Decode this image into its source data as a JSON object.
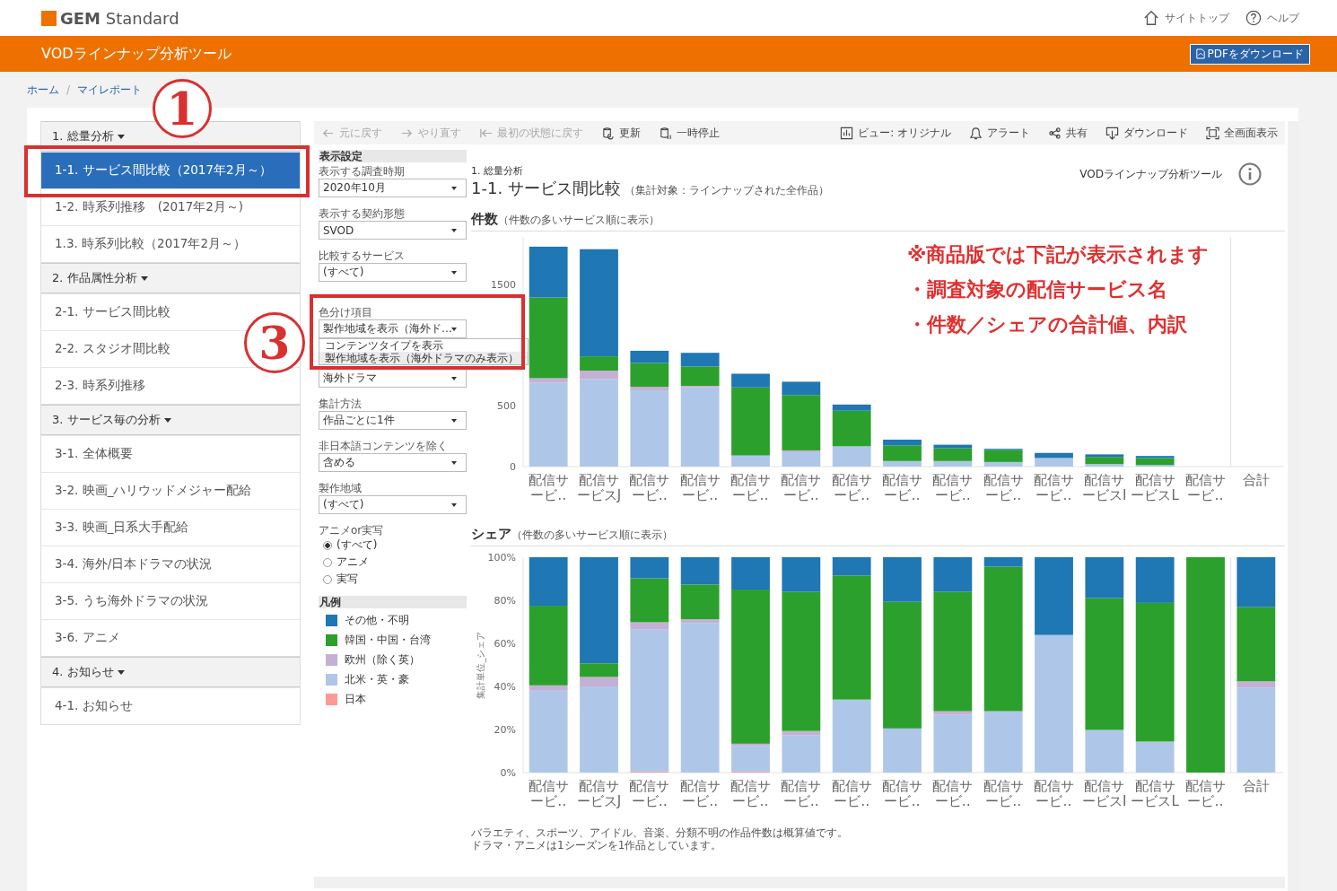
{
  "header": {
    "logo": "**GEM** Standard",
    "links": [
      {
        "label": "サイトトップ"
      },
      {
        "label": "ヘルプ"
      }
    ]
  },
  "app_bar": {
    "title": "VODラインナップ分析ツール",
    "button": "PDFをダウンロード"
  },
  "breadcrumb": {
    "items": [
      "ホーム",
      "マイレポート"
    ],
    "separator": "/"
  },
  "sidebar": {
    "groups": [
      {
        "title": "1. 総量分析",
        "items": [
          {
            "label": "1-1. サービス間比較（2017年2月～）",
            "selected": true
          },
          {
            "label": "1-2. 時系列推移　(2017年2月～)",
            "selected": false
          },
          {
            "label": "1.3. 時系列比較（2017年2月～）",
            "selected": false
          }
        ]
      },
      {
        "title": "2. 作品属性分析",
        "items": [
          {
            "label": "2-1. サービス間比較",
            "selected": false
          },
          {
            "label": "2-2. スタジオ間比較",
            "selected": false
          },
          {
            "label": "2-3. 時系列推移",
            "selected": false
          }
        ]
      },
      {
        "title": "3. サービス毎の分析",
        "items": [
          {
            "label": "3-1. 全体概要",
            "selected": false
          },
          {
            "label": "3-2. 映画_ハリウッドメジャー配給",
            "selected": false
          },
          {
            "label": "3-3. 映画_日系大手配給",
            "selected": false
          },
          {
            "label": "3-4. 海外/日本ドラマの状況",
            "selected": false
          },
          {
            "label": "3-5. うち海外ドラマの状況",
            "selected": false
          },
          {
            "label": "3-6. アニメ",
            "selected": false
          }
        ]
      },
      {
        "title": "4. お知らせ",
        "items": [
          {
            "label": "4-1. お知らせ",
            "selected": false
          }
        ]
      }
    ]
  },
  "toolbar": {
    "left": [
      {
        "label": "元に戻す",
        "disabled": true
      },
      {
        "label": "やり直す",
        "disabled": true
      },
      {
        "label": "最初の状態に戻す",
        "disabled": true
      },
      {
        "label": "更新",
        "disabled": false
      },
      {
        "label": "一時停止",
        "disabled": false
      }
    ],
    "right": [
      {
        "label": "ビュー: オリジナル",
        "disabled": false
      },
      {
        "label": "アラート",
        "disabled": false
      },
      {
        "label": "共有",
        "disabled": false
      },
      {
        "label": "ダウンロード",
        "disabled": false
      },
      {
        "label": "全画面表示",
        "disabled": false
      }
    ]
  },
  "filters": {
    "title": "表示設定",
    "controls": [
      {
        "kind": "select",
        "label": "表示する調査時期",
        "value": "2020年10月"
      },
      {
        "kind": "select",
        "label": "表示する契約形態",
        "value": "SVOD"
      },
      {
        "kind": "select",
        "label": "比較するサービス",
        "value": "(すべて)"
      },
      {
        "kind": "select",
        "label": "色分け項目",
        "value": "製作地域を表示（海外ド…",
        "open": true,
        "options": [
          {
            "label": "コンテンツタイプを表示",
            "selected": false
          },
          {
            "label": "製作地域を表示（海外ドラマのみ表示）",
            "selected": true
          }
        ]
      },
      {
        "kind": "select",
        "value": "海外ドラマ"
      },
      {
        "kind": "select",
        "label": "集計方法",
        "value": "作品ごとに1件"
      },
      {
        "kind": "select",
        "label": "非日本語コンテンツを除く",
        "value": "含める"
      },
      {
        "kind": "select",
        "label": "製作地域",
        "value": "(すべて)"
      },
      {
        "kind": "radio",
        "label": "アニメor実写",
        "options": [
          {
            "label": "(すべて)",
            "selected": true
          },
          {
            "label": "アニメ",
            "selected": false
          },
          {
            "label": "実写",
            "selected": false
          }
        ]
      }
    ],
    "legend": {
      "title": "凡例"
    }
  },
  "report": {
    "section": "1. 総量分析",
    "title": "1-1. サービス間比較",
    "subtitle": "（集計対象：ラインナップされた全作品）",
    "brand": "VODラインナップ分析ツール"
  },
  "count_chart": {
    "title": "件数",
    "subtitle": "（件数の多いサービス順に表示）",
    "notice": [
      "※商品版では下記が表示されます",
      "・調査対象の配信サービス名",
      "・件数／シェアの合計値、内訳"
    ],
    "chart_data": {
      "type": "bar",
      "stacked": true,
      "categories": [
        "配信サービ‥",
        "配信サービスJ",
        "配信サービ‥",
        "配信サービ‥",
        "配信サービ‥",
        "配信サービ‥",
        "配信サービ‥",
        "配信サービ‥",
        "配信サービ‥",
        "配信サービ‥",
        "配信サービ‥",
        "配信サービスI",
        "配信サービスL",
        "配信サービ‥",
        "合計"
      ],
      "ylim": [
        0,
        1900
      ],
      "yticks": [
        0,
        500,
        1500
      ],
      "series": [
        {
          "name": "日本",
          "color": "#ff9896",
          "values": [
            0,
            0,
            0,
            0,
            0,
            0,
            0,
            0,
            0,
            0,
            0,
            0,
            0,
            null,
            null
          ]
        },
        {
          "name": "北米・英・豪",
          "color": "#aec7e8",
          "values": [
            693,
            723,
            630,
            655,
            92,
            118,
            168,
            46,
            46,
            38,
            71,
            21,
            13,
            null,
            null
          ]
        },
        {
          "name": "欧州（除く英）",
          "color": "#c5b0d5",
          "values": [
            38,
            71,
            30,
            13,
            null,
            16,
            0,
            0,
            0,
            0,
            0,
            0,
            0,
            null,
            null
          ]
        },
        {
          "name": "韓国・中国・台湾",
          "color": "#2ca02c",
          "values": [
            668,
            118,
            197,
            160,
            563,
            458,
            294,
            130,
            105,
            101,
            0,
            59,
            58,
            null,
            null
          ]
        },
        {
          "name": "その他・不明",
          "color": "#1f77b4",
          "values": [
            420,
            886,
            101,
            113,
            113,
            110,
            51,
            47,
            30,
            8,
            42,
            21,
            17,
            null,
            null
          ]
        }
      ]
    }
  },
  "share_chart": {
    "title": "シェア",
    "subtitle": "（件数の多いサービス順に表示）",
    "chart_data": {
      "type": "bar",
      "stacked": true,
      "ylabel": "集計単位_シェア",
      "categories": [
        "配信サービ‥",
        "配信サービスJ",
        "配信サービ‥",
        "配信サービ‥",
        "配信サービ‥",
        "配信サービ‥",
        "配信サービ‥",
        "配信サービ‥",
        "配信サービ‥",
        "配信サービ‥",
        "配信サービ‥",
        "配信サービスI",
        "配信サービスL",
        "配信サービ‥",
        "合計"
      ],
      "ylim": [
        0,
        100
      ],
      "yticks": [
        {
          "value": 0,
          "label": "0%"
        },
        {
          "value": 20,
          "label": "20%"
        },
        {
          "value": 40,
          "label": "40%"
        },
        {
          "value": 60,
          "label": "60%"
        },
        {
          "value": 80,
          "label": "80%"
        },
        {
          "value": 100,
          "label": "100%"
        }
      ],
      "series": [
        {
          "color": "#ff9896",
          "values": [
            0,
            0,
            0.5,
            0,
            0.5,
            0,
            0,
            0,
            0,
            0,
            0,
            0,
            0,
            0,
            0
          ]
        },
        {
          "color": "#aec7e8",
          "values": [
            38,
            40,
            66.1,
            69.5,
            11.9,
            17.3,
            33.9,
            20.5,
            26.8,
            28.5,
            63.9,
            19.8,
            14.4,
            0,
            39.5
          ]
        },
        {
          "color": "#c5b0d5",
          "values": [
            2.5,
            4.4,
            3.2,
            1.7,
            1,
            2,
            0,
            0,
            1.7,
            0,
            0,
            0,
            0,
            0,
            2.9
          ]
        },
        {
          "color": "#2ca02c",
          "values": [
            37,
            6.3,
            20.4,
            16.1,
            71.6,
            64.6,
            57.6,
            58.8,
            55.4,
            67.1,
            0,
            61.2,
            64.4,
            100,
            34.4
          ]
        },
        {
          "color": "#1f77b4",
          "values": [
            22.5,
            49.3,
            9.8,
            12.7,
            15,
            16.1,
            8.5,
            20.7,
            16.1,
            4.4,
            36.1,
            19,
            21.2,
            0,
            23.2
          ]
        }
      ]
    }
  },
  "footnotes": [
    "バラエティ、スポーツ、アイドル、音楽、分類不明の作品件数は概算値です。",
    "ドラマ・アニメは1シーズンを1作品としています。"
  ],
  "annotations": [
    {
      "number": "1"
    },
    {
      "number": "3"
    }
  ]
}
